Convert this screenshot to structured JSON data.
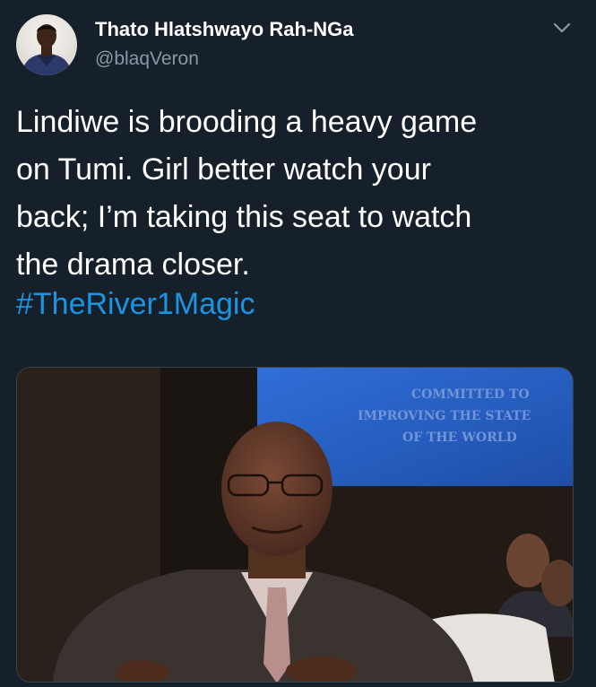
{
  "tweet": {
    "author": {
      "display_name": "Thato Hlatshwayo Rah-NGa",
      "handle": "@blaqVeron",
      "avatar": "user-avatar"
    },
    "menu_icon": "chevron-down-icon",
    "text_lines": [
      "Lindiwe is brooding a heavy game",
      "on Tumi. Girl better watch your",
      "back; I’m taking this seat to watch",
      "the drama closer."
    ],
    "hashtag": "#TheRiver1Magic",
    "media": {
      "kind": "photo",
      "banner_lines": [
        "COMMITTED TO",
        "IMPROVING THE STATE",
        "OF THE WORLD"
      ]
    }
  },
  "colors": {
    "background": "#15202b",
    "text": "#ffffff",
    "secondary_text": "#8899a6",
    "link": "#1b95e0",
    "border": "#38444d"
  }
}
